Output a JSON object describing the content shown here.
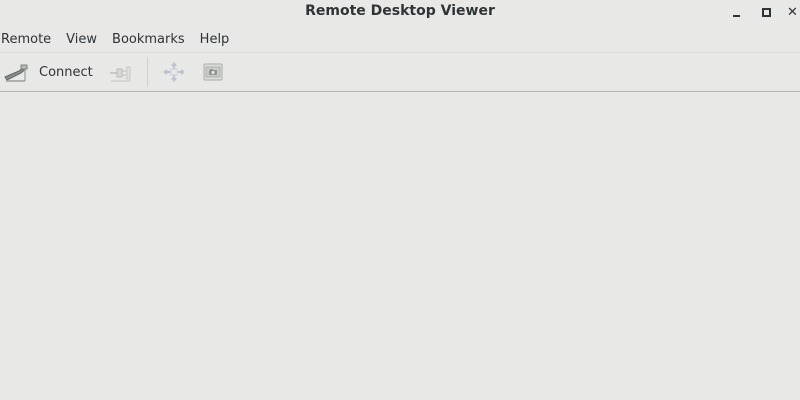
{
  "window": {
    "title": "Remote Desktop Viewer",
    "controls": [
      "minimize-icon",
      "maximize-icon",
      "close-icon"
    ]
  },
  "menubar": {
    "items": [
      {
        "label": "Remote"
      },
      {
        "label": "View"
      },
      {
        "label": "Bookmarks"
      },
      {
        "label": "Help"
      }
    ]
  },
  "toolbar": {
    "connect_label": "Connect",
    "connect_icon": "connect-icon",
    "disconnect_icon": "disconnect-icon",
    "fullscreen_icon": "fullscreen-icon",
    "screenshot_icon": "screenshot-icon"
  },
  "colors": {
    "background": "#e8e8e7",
    "text": "#2e3436",
    "disabled_icon": "#b8c3cf"
  }
}
